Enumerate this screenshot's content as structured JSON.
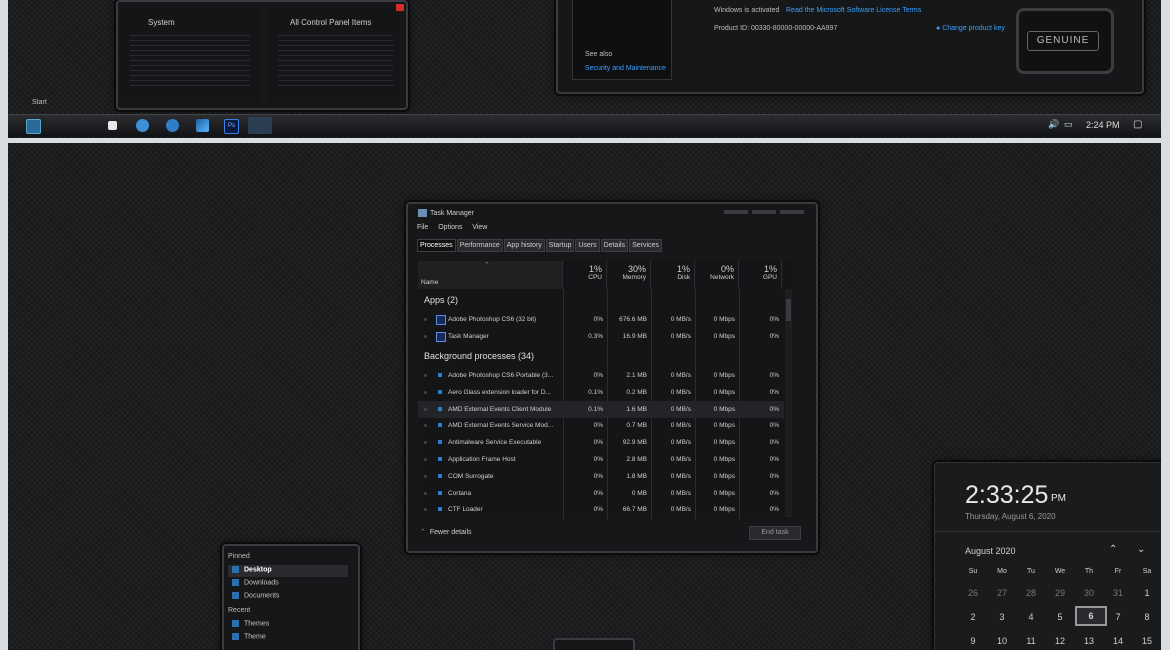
{
  "top": {
    "thumb_system": "System",
    "thumb_control_panel": "All Control Panel Items",
    "start_label": "Start",
    "activation": {
      "status": "Windows is activated",
      "license_link": "Read the Microsoft Software License Terms",
      "product_id": "Product ID: 00330-80000-00000-AA997",
      "change_key": "Change product key",
      "genuine": "GENUINE"
    },
    "see_also": "See also",
    "security_link": "Security and Maintenance",
    "tray_time": "2:24 PM"
  },
  "task_manager": {
    "title": "Task Manager",
    "menu": [
      "File",
      "Options",
      "View"
    ],
    "tabs": [
      "Processes",
      "Performance",
      "App history",
      "Startup",
      "Users",
      "Details",
      "Services"
    ],
    "columns": {
      "name": "Name",
      "cpu_pct": "1%",
      "cpu": "CPU",
      "mem_pct": "30%",
      "mem": "Memory",
      "disk_pct": "1%",
      "disk": "Disk",
      "net_pct": "0%",
      "net": "Network",
      "gpu_pct": "1%",
      "gpu": "GPU"
    },
    "apps_header": "Apps (2)",
    "apps": [
      {
        "name": "Adobe Photoshop CS6 (32 bit)",
        "cpu": "0%",
        "mem": "676.6 MB",
        "disk": "0 MB/s",
        "net": "0 Mbps",
        "gpu": "0%",
        "icon": "photoshop-icon"
      },
      {
        "name": "Task Manager",
        "cpu": "0.3%",
        "mem": "16.9 MB",
        "disk": "0 MB/s",
        "net": "0 Mbps",
        "gpu": "0%",
        "icon": "task-manager-icon"
      }
    ],
    "bg_header": "Background processes (34)",
    "background": [
      {
        "name": "Adobe Photoshop CS6 Portable (3...",
        "cpu": "0%",
        "mem": "2.1 MB",
        "disk": "0 MB/s",
        "net": "0 Mbps",
        "gpu": "0%"
      },
      {
        "name": "Aero Glass extension loader for D...",
        "cpu": "0.1%",
        "mem": "0.2 MB",
        "disk": "0 MB/s",
        "net": "0 Mbps",
        "gpu": "0%"
      },
      {
        "name": "AMD External Events Client Module",
        "cpu": "0.1%",
        "mem": "1.6 MB",
        "disk": "0 MB/s",
        "net": "0 Mbps",
        "gpu": "0%"
      },
      {
        "name": "AMD External Events Service Mod...",
        "cpu": "0%",
        "mem": "0.7 MB",
        "disk": "0 MB/s",
        "net": "0 Mbps",
        "gpu": "0%"
      },
      {
        "name": "Antimalware Service Executable",
        "cpu": "0%",
        "mem": "92.9 MB",
        "disk": "0 MB/s",
        "net": "0 Mbps",
        "gpu": "0%"
      },
      {
        "name": "Application Frame Host",
        "cpu": "0%",
        "mem": "2.8 MB",
        "disk": "0 MB/s",
        "net": "0 Mbps",
        "gpu": "0%"
      },
      {
        "name": "COM Surrogate",
        "cpu": "0%",
        "mem": "1.8 MB",
        "disk": "0 MB/s",
        "net": "0 Mbps",
        "gpu": "0%"
      },
      {
        "name": "Cortana",
        "cpu": "0%",
        "mem": "0 MB",
        "disk": "0 MB/s",
        "net": "0 Mbps",
        "gpu": "0%"
      },
      {
        "name": "CTF Loader",
        "cpu": "0%",
        "mem": "66.7 MB",
        "disk": "0 MB/s",
        "net": "0 Mbps",
        "gpu": "0%"
      }
    ],
    "fewer_details": "Fewer details",
    "end_task": "End task"
  },
  "clock": {
    "time": "2:33:25",
    "ampm": "PM",
    "date": "Thursday, August 6, 2020",
    "month": "August 2020",
    "weekdays": [
      "Su",
      "Mo",
      "Tu",
      "We",
      "Th",
      "Fr",
      "Sa"
    ],
    "weeks": [
      [
        "26",
        "27",
        "28",
        "29",
        "30",
        "31",
        "1"
      ],
      [
        "2",
        "3",
        "4",
        "5",
        "6",
        "7",
        "8"
      ],
      [
        "9",
        "10",
        "11",
        "12",
        "13",
        "14",
        "15"
      ]
    ],
    "today": "6"
  },
  "nav": {
    "pinned": "Pinned",
    "pinned_items": [
      "Desktop",
      "Downloads",
      "Documents"
    ],
    "recent": "Recent",
    "recent_items": [
      "Themes",
      "Theme"
    ]
  },
  "colors": {
    "accent": "#3aa0ff",
    "bg": "#1d1e20"
  }
}
